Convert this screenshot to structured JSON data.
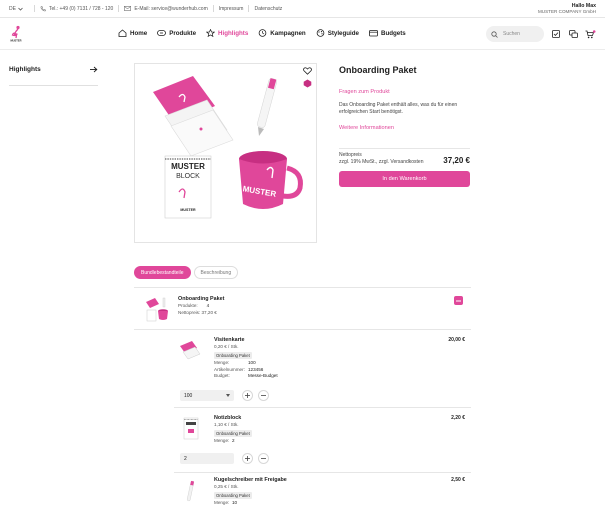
{
  "topbar": {
    "language": "DE",
    "phone": "Tel.: +49 (0) 7131 / 728 - 120",
    "email": "E-Mail: service@wunderhub.com",
    "imprint": "Impressum",
    "privacy": "Datenschutz",
    "user_name": "Hallo Max",
    "company": "MUSTER COMPANY GmbH"
  },
  "brand": {
    "logo_text": "MUSTER",
    "accent": "#e0479a"
  },
  "nav": {
    "items": [
      {
        "label": "Home",
        "icon": "home-icon"
      },
      {
        "label": "Produkte",
        "icon": "product-icon"
      },
      {
        "label": "Highlights",
        "icon": "star-icon",
        "active": true
      },
      {
        "label": "Kampagnen",
        "icon": "clock-icon"
      },
      {
        "label": "Styleguide",
        "icon": "palette-icon"
      },
      {
        "label": "Budgets",
        "icon": "budget-icon"
      }
    ],
    "search_placeholder": "Suchen"
  },
  "sidebar": {
    "title": "Highlights"
  },
  "product": {
    "title": "Onboarding Paket",
    "ask_link": "Fragen zum Produkt",
    "description": "Das Onboarding Paket enthält alles, was du für einen erfolgreichen Start benötigst.",
    "more_link": "Weitere Informationen",
    "net_label": "Nettopreis",
    "tax_label": "zzgl. 19% MwSt., zzgl. Versandkosten",
    "price": "37,20 €",
    "cart_button": "In den Warenkorb",
    "gallery_block_title": "MUSTER",
    "gallery_block_sub": "BLOCK",
    "gallery_block_logo": "MUSTER",
    "gallery_mug_text": "MUSTER"
  },
  "tabs": {
    "components": "Bundlebestandteile",
    "description": "Beschreibung"
  },
  "package": {
    "title": "Onboarding Paket",
    "products_label": "Produkte:",
    "products_value": "4",
    "net_label": "Nettopreis:",
    "net_value": "37,20 €"
  },
  "items": [
    {
      "title": "Visitenkarte",
      "unit_price": "0,20 € / Stk.",
      "badge": "Onboarding Paket",
      "qty_label": "Menge:",
      "qty_value": "100",
      "article_label": "Artikelnummer:",
      "article_value": "123456",
      "budget_label": "Budget:",
      "budget_value": "Messe-Budget",
      "total": "20,00 €",
      "selected_qty": "100"
    },
    {
      "title": "Notizblock",
      "unit_price": "1,10 € / Stk.",
      "badge": "Onboarding Paket",
      "qty_label": "Menge:",
      "qty_value": "2",
      "total": "2,20 €",
      "selected_qty": "2"
    },
    {
      "title": "Kugelschreiber mit Freigabe",
      "unit_price": "0,25 € / Stk.",
      "badge": "Onboarding Paket",
      "qty_label": "Menge:",
      "qty_value": "10",
      "total": "2,50 €"
    }
  ]
}
